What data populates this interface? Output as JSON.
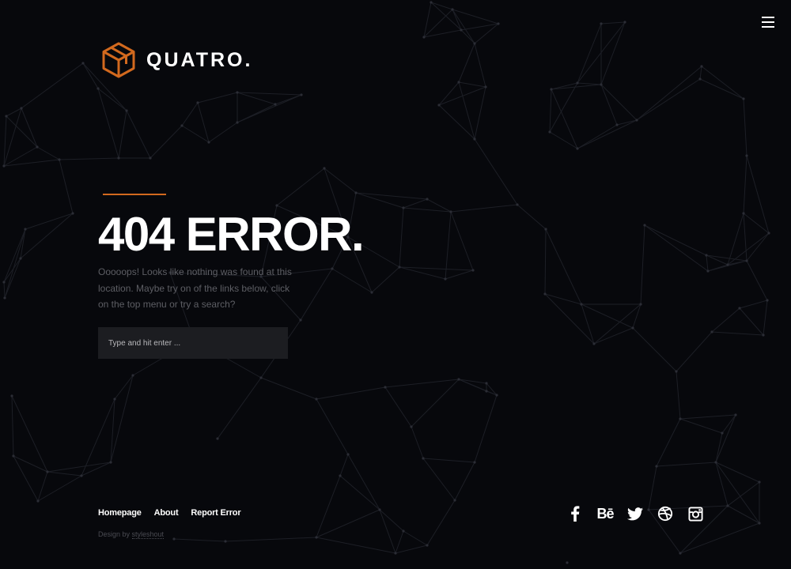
{
  "header": {
    "logo_text": "QUATRO.",
    "logo_icon": "cube-icon",
    "menu_icon": "hamburger-menu-icon"
  },
  "main": {
    "title": "404 ERROR.",
    "message": "Ooooops! Looks like nothing was found at this location. Maybe try on of the links below, click on the top menu or try a search?",
    "search": {
      "placeholder": "Type and hit enter ...",
      "value": ""
    }
  },
  "footer": {
    "nav": [
      {
        "label": "Homepage"
      },
      {
        "label": "About"
      },
      {
        "label": "Report Error"
      }
    ],
    "credit_prefix": "Design by ",
    "credit_link": "styleshout",
    "social": [
      {
        "icon": "facebook-icon"
      },
      {
        "icon": "behance-icon",
        "text": "Bē"
      },
      {
        "icon": "twitter-icon"
      },
      {
        "icon": "dribbble-icon"
      },
      {
        "icon": "instagram-icon"
      }
    ]
  },
  "colors": {
    "background": "#07080c",
    "accent": "#d2691e",
    "text_primary": "#ffffff",
    "text_muted": "#5d5e64",
    "input_background": "#1c1d21"
  }
}
